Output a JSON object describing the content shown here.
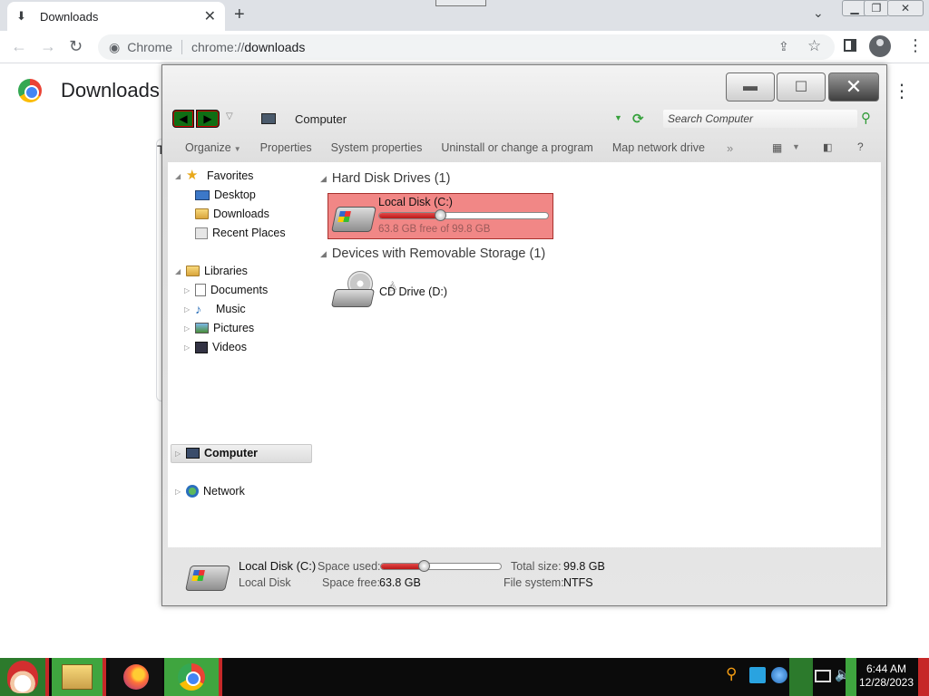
{
  "chrome": {
    "tab": {
      "title": "Downloads",
      "icon": "download-icon"
    },
    "omnibox": {
      "site_label": "Chrome",
      "url_scheme": "chrome://",
      "url_rest": "downloads"
    },
    "page_title": "Downloads",
    "hidden_letter": "T"
  },
  "explorer": {
    "address": "Computer",
    "search_placeholder": "Search Computer",
    "commands": {
      "organize": "Organize",
      "properties": "Properties",
      "system_properties": "System properties",
      "uninstall": "Uninstall or change a program",
      "map_drive": "Map network drive",
      "more": "»",
      "help": "?"
    },
    "nav": {
      "favorites": "Favorites",
      "desktop": "Desktop",
      "downloads": "Downloads",
      "recent": "Recent Places",
      "libraries": "Libraries",
      "documents": "Documents",
      "music": "Music",
      "pictures": "Pictures",
      "videos": "Videos",
      "computer": "Computer",
      "network": "Network"
    },
    "groups": {
      "hdd": "Hard Disk Drives (1)",
      "removable": "Devices with Removable Storage (1)"
    },
    "drives": {
      "c_name": "Local Disk (C:)",
      "c_free_text": "63.8 GB free of 99.8 GB",
      "c_used_fraction": 0.36,
      "d_name": "CD Drive (D:)"
    },
    "details": {
      "name": "Local Disk (C:)",
      "type": "Local Disk",
      "space_used_label": "Space used:",
      "space_free_label": "Space free:",
      "space_free_value": "63.8 GB",
      "total_size_label": "Total size:",
      "total_size_value": "99.8 GB",
      "file_system_label": "File system:",
      "file_system_value": "NTFS"
    }
  },
  "taskbar": {
    "time": "6:44 AM",
    "date": "12/28/2023"
  },
  "colors": {
    "selected_drive": "#f18786",
    "usage_bar": "#c62828",
    "taskbar_green": "#3fa53f",
    "taskbar_red": "#c62828"
  }
}
